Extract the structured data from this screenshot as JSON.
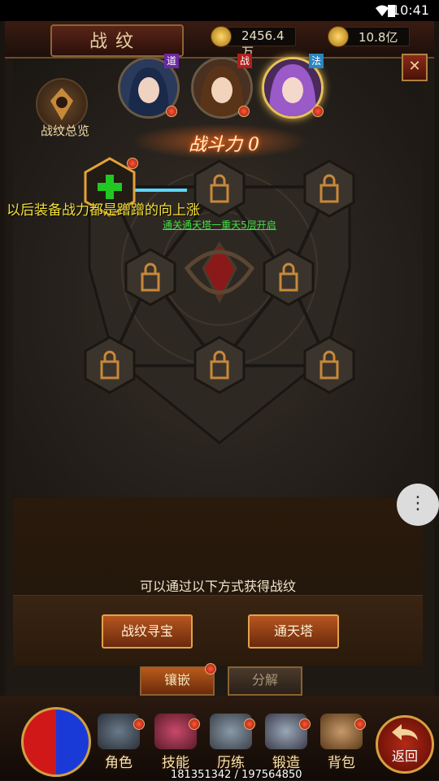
{
  "status_bar": {
    "time": "10:41"
  },
  "header": {
    "title": "战纹",
    "currencies": [
      {
        "icon": "gold-ingot-icon",
        "value": "2456.4万"
      },
      {
        "icon": "yuanbao-icon",
        "value": "10.8亿"
      }
    ],
    "close_label": "✕"
  },
  "overview": {
    "label": "战纹总览"
  },
  "heroes": [
    {
      "tag": "道",
      "tag_color": "#6a2aa0"
    },
    {
      "tag": "战",
      "tag_color": "#b0201a"
    },
    {
      "tag": "法",
      "tag_color": "#2a86c0",
      "selected": true
    }
  ],
  "power": {
    "label": "战斗力",
    "value": "0"
  },
  "overlay_text": "以后装备战力都是蹭蹭的向上涨",
  "unlock_hint": "通关通天塔一重天5层开启",
  "acquire": {
    "hint": "可以通过以下方式获得战纹",
    "buttons": [
      "战纹寻宝",
      "通天塔"
    ]
  },
  "tabs": [
    {
      "label": "镶嵌",
      "active": true
    },
    {
      "label": "分解",
      "active": false
    }
  ],
  "bottom_nav": [
    {
      "label": "角色",
      "icon": "helmet-icon"
    },
    {
      "label": "技能",
      "icon": "skill-book-icon"
    },
    {
      "label": "历练",
      "icon": "armor-icon"
    },
    {
      "label": "锻造",
      "icon": "anvil-icon"
    },
    {
      "label": "背包",
      "icon": "bag-icon"
    }
  ],
  "back_label": "返回",
  "exp_text": "181351342 / 197564850",
  "more_label": "⋮"
}
